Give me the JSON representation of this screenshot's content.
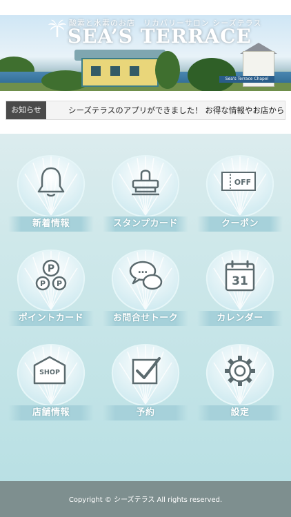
{
  "header": {
    "tagline": "酸素と水素のお店　リカバリーサロン シーズテラス",
    "brand_name": "SEA’S TERRACE",
    "sign_text": "Sea's Terrace Chapel"
  },
  "news": {
    "label": "お知らせ",
    "text": "シーズテラスのアプリができました！ お得な情報やお店からのお知らせ"
  },
  "menu": {
    "items": [
      {
        "label": "新着情報",
        "icon": "bell-icon"
      },
      {
        "label": "スタンプカード",
        "icon": "stamp-icon"
      },
      {
        "label": "クーポン",
        "icon": "coupon-icon",
        "icon_text": "OFF"
      },
      {
        "label": "ポイントカード",
        "icon": "points-icon",
        "icon_text": "P"
      },
      {
        "label": "お問合せトーク",
        "icon": "chat-icon",
        "icon_text": "…"
      },
      {
        "label": "カレンダー",
        "icon": "calendar-icon",
        "icon_text": "31"
      },
      {
        "label": "店舗情報",
        "icon": "shop-icon",
        "icon_text": "SHOP"
      },
      {
        "label": "予約",
        "icon": "checkbox-icon"
      },
      {
        "label": "設定",
        "icon": "gear-icon"
      }
    ]
  },
  "footer": {
    "copyright": "Copyright © シーズテラス All rights reserved."
  },
  "colors": {
    "background_top": "#dcecee",
    "background_bottom": "#b9e0e4",
    "label_band": "#a6d1da",
    "footer": "#7e8f8f",
    "news_label_bg": "#4a4a4a"
  }
}
